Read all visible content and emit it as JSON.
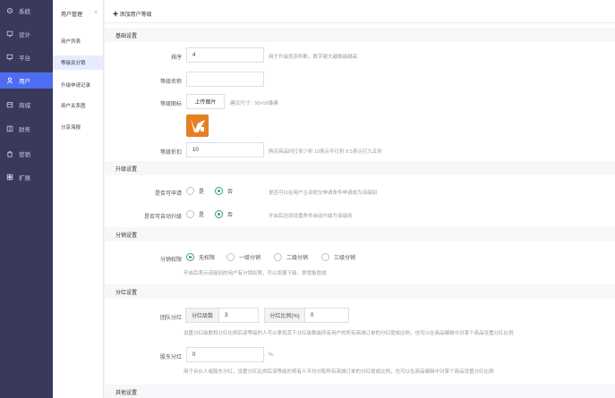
{
  "nav": {
    "items": [
      {
        "label": "系統",
        "icon": "gear-icon"
      },
      {
        "label": "设计",
        "icon": "monitor-icon"
      },
      {
        "label": "平台",
        "icon": "monitor-icon"
      },
      {
        "label": "用户",
        "icon": "user-icon"
      },
      {
        "label": "商城",
        "icon": "shop-icon"
      },
      {
        "label": "财务",
        "icon": "wallet-icon"
      },
      {
        "label": "营销",
        "icon": "bag-icon"
      },
      {
        "label": "扩展",
        "icon": "grid-icon"
      }
    ],
    "active": "用户"
  },
  "subnav": {
    "title": "用户管理",
    "collapse_glyph": "«",
    "items": [
      "用户列表",
      "等级及分销",
      "升级申请记录",
      "用户关系图",
      "分享海报"
    ],
    "active": "等级及分销"
  },
  "page": {
    "title": "✚ 添加用户等级"
  },
  "colors": {
    "accent": "#4e6ef2",
    "nav_bg": "#39395d",
    "radio_on": "#3aa26b",
    "logo": "#e67e22"
  },
  "basic": {
    "section": "基础设置",
    "sort_label": "排序",
    "sort_value": "4",
    "sort_hint": "用于升级划序判断，数字越大越晚级越高",
    "name_label": "等级名称",
    "name_value": "",
    "icon_label": "等级图标",
    "upload_label": "上传图片",
    "icon_hint": "建议尺寸：50×50像素",
    "discount_label": "等级折扣",
    "discount_value": "10",
    "discount_hint": "购买商品时打多少折 10表示不打折 9.5表示打九五折"
  },
  "upgrade": {
    "section": "升级设置",
    "apply_label": "是否可申请",
    "apply_yes": "是",
    "apply_no": "否",
    "apply_hint": "是否可以在用户主动提交申请条件申请成为该级别",
    "auto_label": "是否可自动升级",
    "auto_yes": "是",
    "auto_no": "否",
    "auto_hint": "开启后达到设置条件自动升级为该级别"
  },
  "distribution": {
    "section": "分销设置",
    "perm_label": "分销权限",
    "options": [
      "无权限",
      "一级分销",
      "二级分销",
      "三级分销"
    ],
    "selected": "无权限",
    "perm_hint": "开启后表示该级别的用户有分销权限，可以发展下级，拿销售提成"
  },
  "dividend": {
    "section": "分红设置",
    "team_label": "团队分红",
    "levels_label": "分红级数",
    "levels_value": "3",
    "ratio_label": "分红比例(%)",
    "ratio_value": "0",
    "team_hint": "设置分红级数和分红比例后该等级的人可以拿到其下分红级数级所有用户的所有商城订单的分红提成比例，也可以在商品编辑中对某个商品设置分红比例",
    "shareholder_label": "股东分红",
    "shareholder_value": "0",
    "shareholder_unit": "%",
    "shareholder_hint": "用于合伙人或股东分红，设置分红比例后该等级的将有人平均分配所有商城订单的分红提成比例，也可以在商品编辑中对某个商品设置分红比例"
  },
  "other": {
    "section": "其他设置"
  }
}
